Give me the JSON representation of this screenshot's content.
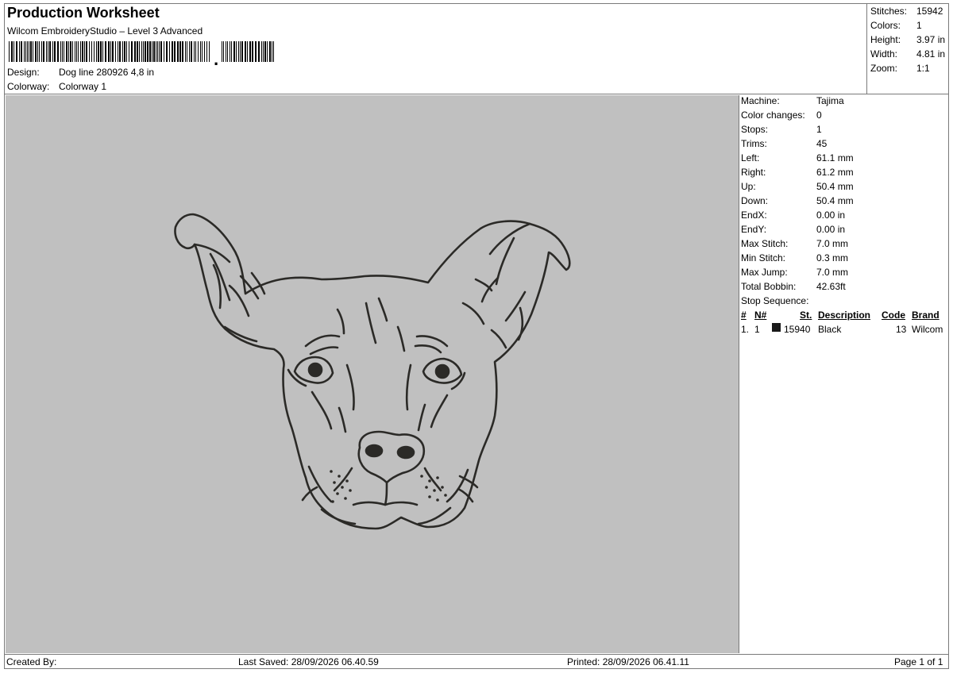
{
  "header": {
    "title": "Production Worksheet",
    "software": "Wilcom EmbroideryStudio – Level 3 Advanced",
    "barcode_suffix": ",",
    "design_label": "Design:",
    "design_value": "Dog line 280926 4,8 in",
    "colorway_label": "Colorway:",
    "colorway_value": "Colorway 1"
  },
  "summary": [
    {
      "label": "Stitches:",
      "value": "15942"
    },
    {
      "label": "Colors:",
      "value": "1"
    },
    {
      "label": "Height:",
      "value": "3.97 in"
    },
    {
      "label": "Width:",
      "value": "4.81 in"
    },
    {
      "label": "Zoom:",
      "value": "1:1"
    }
  ],
  "details": [
    {
      "label": "Machine:",
      "value": "Tajima"
    },
    {
      "label": "Color changes:",
      "value": "0"
    },
    {
      "label": "Stops:",
      "value": "1"
    },
    {
      "label": "Trims:",
      "value": "45"
    },
    {
      "label": "Left:",
      "value": "61.1 mm"
    },
    {
      "label": "Right:",
      "value": "61.2 mm"
    },
    {
      "label": "Up:",
      "value": "50.4 mm"
    },
    {
      "label": "Down:",
      "value": "50.4 mm"
    },
    {
      "label": "EndX:",
      "value": "0.00 in"
    },
    {
      "label": "EndY:",
      "value": "0.00 in"
    },
    {
      "label": "Max Stitch:",
      "value": "7.0 mm"
    },
    {
      "label": "Min Stitch:",
      "value": "0.3 mm"
    },
    {
      "label": "Max Jump:",
      "value": "7.0 mm"
    },
    {
      "label": "Total Bobbin:",
      "value": "42.63ft"
    },
    {
      "label": "Stop Sequence:",
      "value": ""
    }
  ],
  "stop_table": {
    "headers": {
      "num": "#",
      "n": "N#",
      "st": "St.",
      "description": "Description",
      "code": "Code",
      "brand": "Brand"
    },
    "rows": [
      {
        "num": "1.",
        "n": "1",
        "swatch_color": "#1a1a1a",
        "st": "15940",
        "description": "Black",
        "code": "13",
        "brand": "Wilcom"
      }
    ]
  },
  "footer": {
    "created_by": "Created By:",
    "last_saved": "Last Saved: 28/09/2026 06.40.59",
    "printed": "Printed: 28/09/2026 06.41.11",
    "page": "Page 1 of 1"
  },
  "colors": {
    "canvas_bg": "#c0c0c0",
    "thread": "#2b2a27"
  }
}
